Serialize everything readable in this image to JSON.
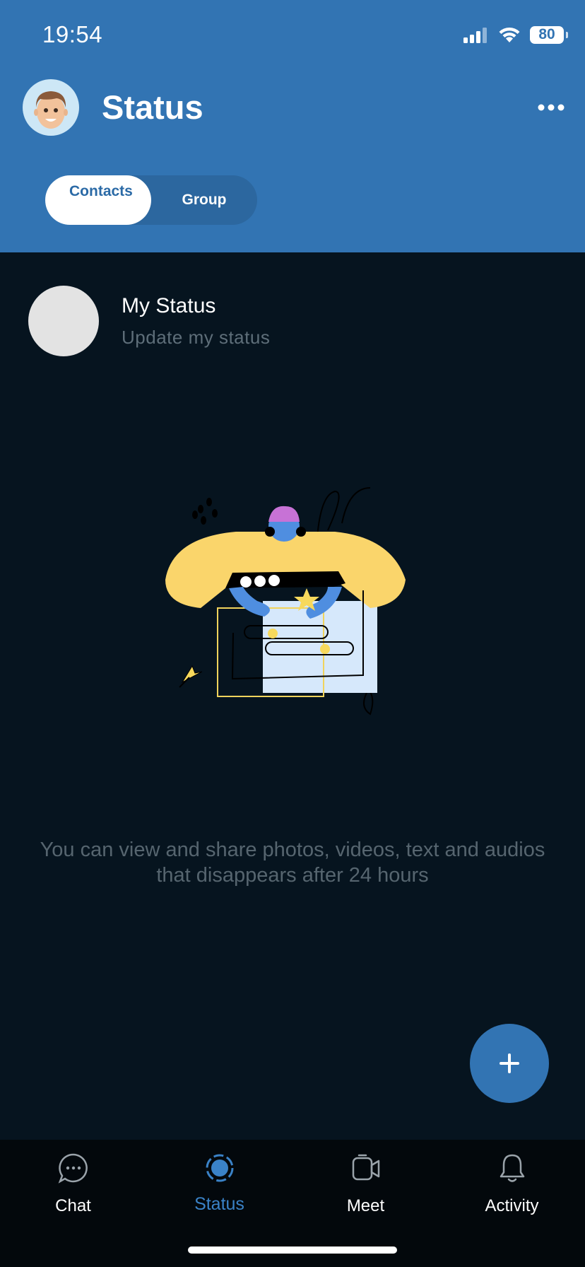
{
  "status_bar": {
    "time": "19:54",
    "battery": "80"
  },
  "header": {
    "title": "Status"
  },
  "segments": {
    "active": "Contacts",
    "other": "Group"
  },
  "my_status": {
    "name": "My Status",
    "subtitle": "Update my status"
  },
  "info_text": "You can view and share photos, videos, text and audios that disappears after 24 hours",
  "fab": {
    "label": "+"
  },
  "tabs": [
    {
      "label": "Chat",
      "icon": "chat-bubble-icon"
    },
    {
      "label": "Status",
      "icon": "status-icon"
    },
    {
      "label": "Meet",
      "icon": "video-camera-icon"
    },
    {
      "label": "Activity",
      "icon": "bell-icon"
    }
  ],
  "colors": {
    "header": "#3274b3",
    "background": "#06141f",
    "accent": "#3a82c7",
    "tabbar": "#03080c"
  }
}
